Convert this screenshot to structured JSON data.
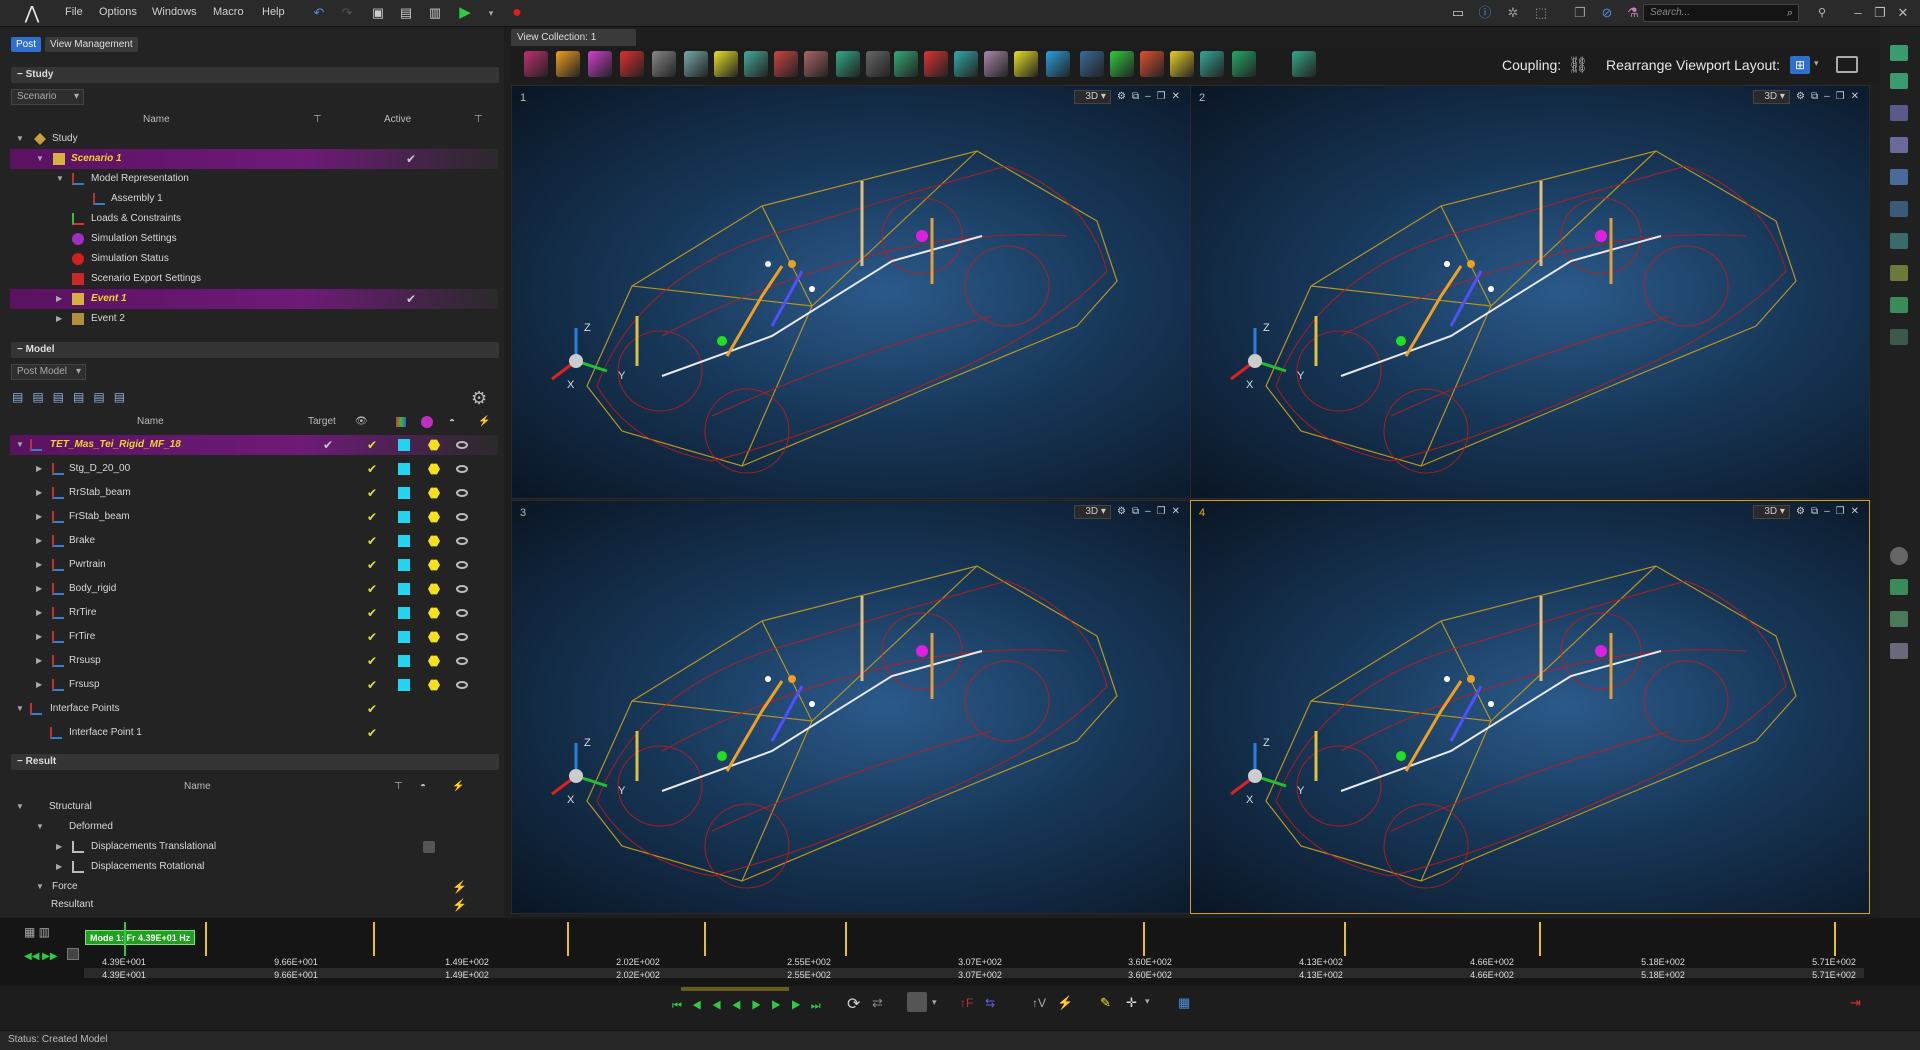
{
  "menu": {
    "items": [
      "File",
      "Options",
      "Windows",
      "Macro",
      "Help"
    ]
  },
  "search": {
    "placeholder": "Search..."
  },
  "tabs": {
    "post": "Post",
    "view_management": "View Management"
  },
  "study": {
    "header": "Study",
    "dropdown": "Scenario",
    "col_name": "Name",
    "col_active": "Active",
    "rows": [
      {
        "label": "Study"
      },
      {
        "label": "Scenario 1",
        "active": "✔"
      },
      {
        "label": "Model Representation"
      },
      {
        "label": "Assembly 1"
      },
      {
        "label": "Loads & Constraints"
      },
      {
        "label": "Simulation Settings"
      },
      {
        "label": "Simulation Status"
      },
      {
        "label": "Scenario Export Settings"
      },
      {
        "label": "Event 1",
        "active": "✔"
      },
      {
        "label": "Event 2"
      }
    ]
  },
  "model": {
    "header": "Model",
    "dropdown": "Post Model",
    "col_name": "Name",
    "col_target": "Target",
    "rows": [
      {
        "label": "TET_Mas_Tei_Rigid_MF_18"
      },
      {
        "label": "Stg_D_20_00"
      },
      {
        "label": "RrStab_beam"
      },
      {
        "label": "FrStab_beam"
      },
      {
        "label": "Brake"
      },
      {
        "label": "Pwrtrain"
      },
      {
        "label": "Body_rigid"
      },
      {
        "label": "RrTire"
      },
      {
        "label": "FrTire"
      },
      {
        "label": "Rrsusp"
      },
      {
        "label": "Frsusp"
      },
      {
        "label": "Interface Points"
      },
      {
        "label": "Interface Point 1"
      }
    ]
  },
  "result": {
    "header": "Result",
    "col_name": "Name",
    "rows": [
      {
        "label": "Structural"
      },
      {
        "label": "Deformed"
      },
      {
        "label": "Displacements Translational"
      },
      {
        "label": "Displacements Rotational"
      },
      {
        "label": "Force"
      },
      {
        "label": "Resultant"
      }
    ]
  },
  "viewport": {
    "collection_tab": "View Collection: 1",
    "coupling_label": "Coupling:",
    "rearrange_label": "Rearrange Viewport Layout:",
    "view_mode": "3D",
    "numbers": [
      "1",
      "2",
      "3",
      "4"
    ],
    "axis_x": "X",
    "axis_y": "Y",
    "axis_z": "Z"
  },
  "timeline": {
    "mode_label": "Mode 1: Fr 4.39E+01 Hz",
    "values": [
      "4.39E+001",
      "9.66E+001",
      "1.49E+002",
      "2.02E+002",
      "2.55E+002",
      "3.07E+002",
      "3.60E+002",
      "4.13E+002",
      "4.66E+002",
      "5.18E+002",
      "5.71E+002"
    ]
  },
  "status": {
    "label": "Status:",
    "text": "Created Model"
  },
  "colors": {
    "accent": "#d4a21a",
    "selection": "#6e1a78",
    "wire_red": "#c41a1a",
    "wire_gold": "#b89420"
  }
}
